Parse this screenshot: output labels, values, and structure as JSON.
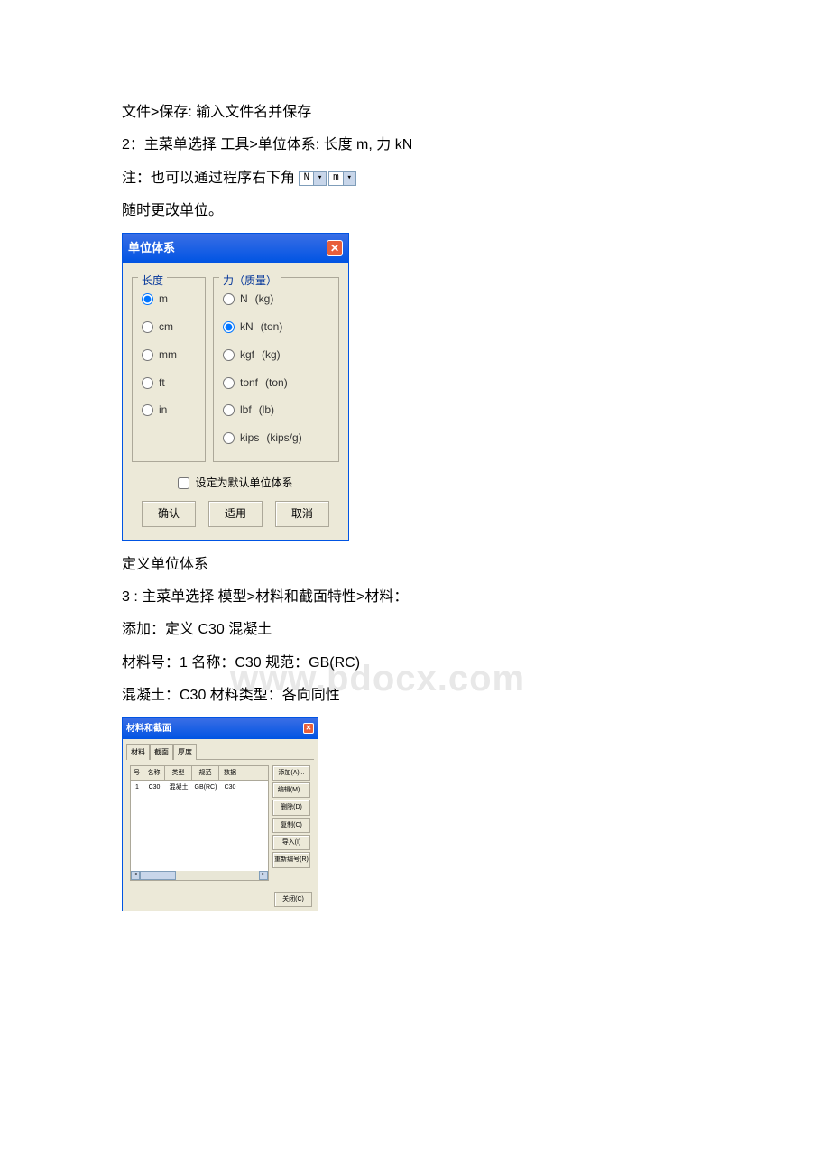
{
  "text": {
    "p1": " 文件>保存: 输入文件名并保存",
    "p2": "2：主菜单选择 工具>单位体系: 长度 m, 力 kN",
    "p3_prefix": "注：也可以通过程序右下角",
    "p4": "随时更改单位。",
    "caption1": " 定义单位体系",
    "p5": "3 : 主菜单选择 模型>材料和截面特性>材料：",
    "p6": "添加：定义 C30 混凝土",
    "p7": "材料号：1 名称：C30 规范：GB(RC)",
    "p8": "混凝土：C30 材料类型：各向同性"
  },
  "dropdowns": {
    "unit1": "N",
    "unit2": "m"
  },
  "unit_dialog": {
    "title": "单位体系",
    "close": "✕",
    "length_group": "长度",
    "force_group": "力（质量）",
    "length_options": [
      {
        "label": "m",
        "checked": true
      },
      {
        "label": "cm",
        "checked": false
      },
      {
        "label": "mm",
        "checked": false
      },
      {
        "label": "ft",
        "checked": false
      },
      {
        "label": "in",
        "checked": false
      }
    ],
    "force_options": [
      {
        "label": "N",
        "sub": "(kg)",
        "checked": false
      },
      {
        "label": "kN",
        "sub": "(ton)",
        "checked": true
      },
      {
        "label": "kgf",
        "sub": "(kg)",
        "checked": false
      },
      {
        "label": "tonf",
        "sub": "(ton)",
        "checked": false
      },
      {
        "label": "lbf",
        "sub": "(lb)",
        "checked": false
      },
      {
        "label": "kips",
        "sub": "(kips/g)",
        "checked": false
      }
    ],
    "default_checkbox": "设定为默认单位体系",
    "btn_ok": "确认",
    "btn_apply": "适用",
    "btn_cancel": "取消"
  },
  "watermark": "www.bdocx.com",
  "mat_dialog": {
    "title": "材料和截面",
    "close": "✕",
    "tabs": [
      {
        "label": "材料",
        "active": true
      },
      {
        "label": "截面",
        "active": false
      },
      {
        "label": "厚度",
        "active": false
      }
    ],
    "headers": {
      "no": "号",
      "name": "名称",
      "type": "类型",
      "std": "规范",
      "db": "数据"
    },
    "row": {
      "no": "1",
      "name": "C30",
      "type": "混凝土",
      "std": "GB(RC)",
      "db": "C30"
    },
    "buttons": {
      "add": "添加(A)...",
      "edit": "编辑(M)...",
      "delete": "删除(D)",
      "copy": "复制(C)",
      "import": "导入(I)",
      "renumber": "重新编号(R)"
    },
    "close_btn": "关闭(C)"
  }
}
